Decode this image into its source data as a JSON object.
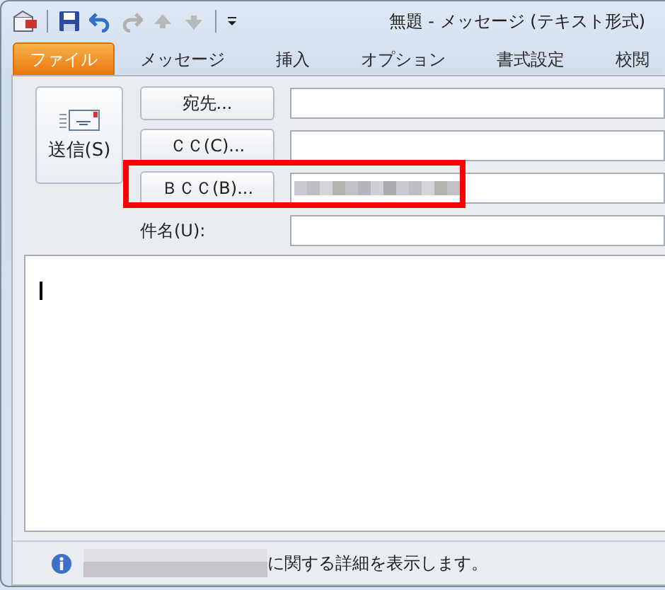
{
  "window": {
    "title": "無題 - メッセージ (テキスト形式)"
  },
  "quick_access": [
    {
      "kind": "save",
      "disabled": false
    },
    {
      "kind": "undo",
      "disabled": false
    },
    {
      "kind": "redo",
      "disabled": true
    },
    {
      "kind": "up",
      "disabled": true
    },
    {
      "kind": "down",
      "disabled": true
    }
  ],
  "tabs": [
    {
      "label": "ファイル",
      "selected": true
    },
    {
      "label": "メッセージ",
      "selected": false
    },
    {
      "label": "挿入",
      "selected": false
    },
    {
      "label": "オプション",
      "selected": false
    },
    {
      "label": "書式設定",
      "selected": false
    },
    {
      "label": "校閲",
      "selected": false
    }
  ],
  "send_button": {
    "label": "送信(S)"
  },
  "address_rows": [
    {
      "kind": "button",
      "label": "宛先...",
      "highlighted": false,
      "value_redacted": false
    },
    {
      "kind": "button",
      "label": "ＣＣ(C)...",
      "highlighted": false,
      "value_redacted": false
    },
    {
      "kind": "button",
      "label": "ＢＣＣ(B)...",
      "highlighted": true,
      "value_redacted": true
    },
    {
      "kind": "label",
      "label": "件名(U):",
      "highlighted": false,
      "value_redacted": false
    }
  ],
  "status_bar": {
    "message": "に関する詳細を表示します。",
    "prefix_redacted": true
  }
}
